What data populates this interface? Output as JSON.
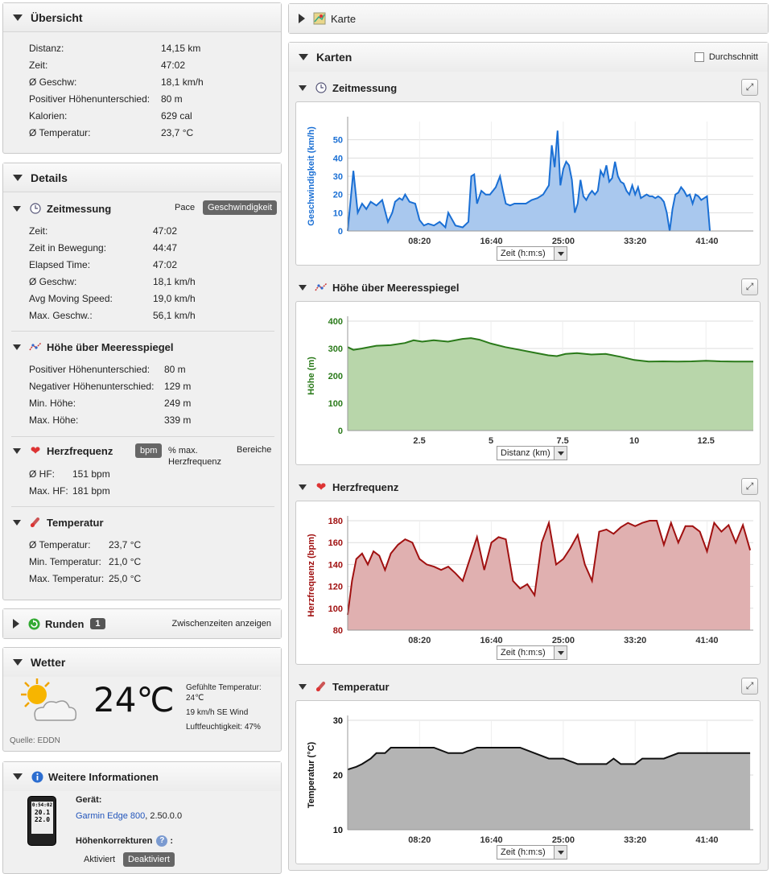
{
  "overview": {
    "title": "Übersicht",
    "rows": [
      {
        "label": "Distanz:",
        "value": "14,15 km"
      },
      {
        "label": "Zeit:",
        "value": "47:02"
      },
      {
        "label": "Ø Geschw:",
        "value": "18,1 km/h"
      },
      {
        "label": "Positiver Höhenunterschied:",
        "value": "80 m"
      },
      {
        "label": "Kalorien:",
        "value": "629 cal"
      },
      {
        "label": "Ø Temperatur:",
        "value": "23,7 °C"
      }
    ]
  },
  "details": {
    "title": "Details",
    "timing": {
      "title": "Zeitmessung",
      "pace_label": "Pace",
      "speed_label": "Geschwindigkeit",
      "rows": [
        {
          "label": "Zeit:",
          "value": "47:02"
        },
        {
          "label": "Zeit in Bewegung:",
          "value": "44:47"
        },
        {
          "label": "Elapsed Time:",
          "value": "47:02"
        },
        {
          "label": "Ø Geschw:",
          "value": "18,1 km/h"
        },
        {
          "label": "Avg Moving Speed:",
          "value": "19,0 km/h"
        },
        {
          "label": "Max. Geschw.:",
          "value": "56,1 km/h"
        }
      ]
    },
    "elevation": {
      "title": "Höhe über Meeresspiegel",
      "rows": [
        {
          "label": "Positiver Höhenunterschied:",
          "value": "80 m"
        },
        {
          "label": "Negativer Höhenunterschied:",
          "value": "129 m"
        },
        {
          "label": "Min. Höhe:",
          "value": "249 m"
        },
        {
          "label": "Max. Höhe:",
          "value": "339 m"
        }
      ]
    },
    "heartrate": {
      "title": "Herzfrequenz",
      "bpm_label": "bpm",
      "pct_label": "% max. Herzfrequenz",
      "zones_label": "Bereiche",
      "rows": [
        {
          "label": "Ø HF:",
          "value": "151 bpm"
        },
        {
          "label": "Max. HF:",
          "value": "181 bpm"
        }
      ]
    },
    "temperature": {
      "title": "Temperatur",
      "rows": [
        {
          "label": "Ø Temperatur:",
          "value": "23,7 °C"
        },
        {
          "label": "Min. Temperatur:",
          "value": "21,0 °C"
        },
        {
          "label": "Max. Temperatur:",
          "value": "25,0 °C"
        }
      ]
    }
  },
  "laps": {
    "title": "Runden",
    "count": "1",
    "link": "Zwischenzeiten anzeigen"
  },
  "weather": {
    "title": "Wetter",
    "temp": "24℃",
    "feels": "Gefühlte Temperatur: 24℃",
    "wind": "19 km/h SE Wind",
    "humidity": "Luftfeuchtigkeit: 47%",
    "source": "Quelle: EDDN"
  },
  "info": {
    "title": "Weitere Informationen",
    "device_label": "Gerät:",
    "device_name": "Garmin Edge 800",
    "device_version": ", 2.50.0.0",
    "elev_corr_label": "Höhenkorrekturen",
    "enabled": "Aktiviert",
    "disabled": "Deaktiviert",
    "screen_line1": "0:54:02",
    "screen_line2": "20.1",
    "screen_line3": "22.0"
  },
  "map": {
    "title": "Karte"
  },
  "charts_panel": {
    "title": "Karten",
    "average_label": "Durchschnitt"
  },
  "charts": [
    {
      "key": "speed",
      "title": "Zeitmessung",
      "ylabel": "Geschwindigkeit (km/h)",
      "selector": "Zeit (h:m:s)",
      "color": "#1a6fd4",
      "fill": "#a9c8ee",
      "chart_data": {
        "type": "area",
        "xlim": [
          0,
          2822
        ],
        "ylim": [
          0,
          60
        ],
        "yticks": [
          0,
          10,
          20,
          30,
          40,
          50
        ],
        "xticks": [
          500,
          1000,
          1500,
          2000,
          2500
        ],
        "xtick_labels": [
          "08:20",
          "16:40",
          "25:00",
          "33:20",
          "41:40"
        ],
        "x": [
          0,
          40,
          70,
          100,
          130,
          160,
          200,
          240,
          280,
          310,
          330,
          360,
          380,
          400,
          430,
          470,
          500,
          530,
          560,
          600,
          640,
          680,
          700,
          750,
          800,
          840,
          860,
          880,
          900,
          930,
          960,
          990,
          1030,
          1060,
          1080,
          1100,
          1130,
          1160,
          1200,
          1240,
          1280,
          1320,
          1360,
          1400,
          1420,
          1440,
          1460,
          1480,
          1500,
          1520,
          1540,
          1560,
          1580,
          1600,
          1620,
          1640,
          1660,
          1680,
          1700,
          1720,
          1740,
          1760,
          1780,
          1800,
          1820,
          1840,
          1860,
          1880,
          1900,
          1920,
          1940,
          1960,
          1980,
          2000,
          2020,
          2040,
          2060,
          2080,
          2100,
          2120,
          2140,
          2160,
          2180,
          2200,
          2220,
          2240,
          2260,
          2280,
          2300,
          2320,
          2340,
          2360,
          2380,
          2400,
          2420,
          2440,
          2460,
          2480,
          2500,
          2520,
          2540,
          2560,
          2580,
          2600,
          2620,
          2640,
          2660,
          2680,
          2700,
          2720,
          2740,
          2760,
          2780,
          2800
        ],
        "y": [
          0,
          33,
          10,
          15,
          12,
          16,
          14,
          17,
          5,
          10,
          16,
          18,
          17,
          20,
          16,
          15,
          6,
          3,
          4,
          3,
          5,
          2,
          10,
          3,
          2,
          5,
          30,
          31,
          15,
          22,
          20,
          20,
          24,
          30,
          22,
          15,
          14,
          15,
          15,
          15,
          17,
          18,
          20,
          25,
          47,
          35,
          55,
          25,
          34,
          38,
          36,
          28,
          10,
          15,
          28,
          19,
          17,
          20,
          22,
          20,
          22,
          33,
          30,
          36,
          27,
          29,
          38,
          30,
          27,
          26,
          22,
          20,
          25,
          20,
          24,
          18,
          19,
          20,
          19,
          19,
          18,
          19,
          18,
          16,
          10,
          0,
          12,
          20,
          21,
          24,
          22,
          19,
          20,
          15,
          20,
          19,
          17,
          18,
          19,
          0
        ],
        "series": [
          {
            "name": "",
            "values": []
          }
        ]
      }
    },
    {
      "key": "elevation",
      "title": "Höhe über Meeresspiegel",
      "ylabel": "Höhe (m)",
      "selector": "Distanz (km)",
      "color": "#2a7a1a",
      "fill": "#b8d6aa",
      "chart_data": {
        "type": "area",
        "xlim": [
          0,
          14.15
        ],
        "ylim": [
          0,
          400
        ],
        "yticks": [
          0,
          100,
          200,
          300,
          400
        ],
        "xticks": [
          2.5,
          5,
          7.5,
          10,
          12.5
        ],
        "xtick_labels": [
          "2.5",
          "5",
          "7.5",
          "10",
          "12.5"
        ],
        "x": [
          0,
          0.2,
          0.5,
          1,
          1.5,
          2,
          2.3,
          2.6,
          3,
          3.5,
          4,
          4.3,
          4.6,
          5,
          5.5,
          6,
          6.5,
          7,
          7.3,
          7.6,
          8,
          8.5,
          9,
          9.5,
          10,
          10.5,
          11,
          11.5,
          12,
          12.5,
          13,
          13.5,
          14.15
        ],
        "y": [
          305,
          295,
          300,
          310,
          312,
          320,
          330,
          325,
          330,
          325,
          335,
          338,
          332,
          318,
          305,
          295,
          285,
          275,
          272,
          280,
          283,
          278,
          280,
          270,
          258,
          252,
          253,
          252,
          253,
          255,
          253,
          252,
          252
        ]
      }
    },
    {
      "key": "heartrate",
      "title": "Herzfrequenz",
      "ylabel": "Herzfrequenz (bpm)",
      "selector": "Zeit (h:m:s)",
      "color": "#a01010",
      "fill": "#e0b0b0",
      "chart_data": {
        "type": "area",
        "xlim": [
          0,
          2822
        ],
        "ylim": [
          80,
          180
        ],
        "yticks": [
          80,
          100,
          120,
          140,
          160,
          180
        ],
        "xticks": [
          500,
          1000,
          1500,
          2000,
          2500
        ],
        "xtick_labels": [
          "08:20",
          "16:40",
          "25:00",
          "33:20",
          "41:40"
        ],
        "x": [
          0,
          30,
          60,
          100,
          140,
          180,
          220,
          260,
          300,
          350,
          400,
          450,
          500,
          550,
          600,
          650,
          700,
          750,
          800,
          850,
          900,
          950,
          1000,
          1050,
          1100,
          1150,
          1200,
          1250,
          1300,
          1350,
          1400,
          1450,
          1500,
          1550,
          1600,
          1650,
          1700,
          1750,
          1800,
          1850,
          1900,
          1950,
          2000,
          2050,
          2100,
          2150,
          2200,
          2250,
          2300,
          2350,
          2400,
          2450,
          2500,
          2550,
          2600,
          2650,
          2700,
          2750,
          2800
        ],
        "y": [
          94,
          125,
          145,
          150,
          140,
          152,
          148,
          135,
          150,
          158,
          163,
          160,
          145,
          140,
          138,
          135,
          138,
          132,
          125,
          145,
          165,
          135,
          160,
          165,
          163,
          125,
          118,
          122,
          112,
          160,
          178,
          140,
          145,
          155,
          167,
          140,
          125,
          170,
          172,
          168,
          174,
          178,
          175,
          178,
          180,
          180,
          158,
          178,
          160,
          175,
          175,
          170,
          152,
          178,
          170,
          176,
          160,
          176,
          153
        ]
      }
    },
    {
      "key": "temperature",
      "title": "Temperatur",
      "ylabel": "Temperatur (°C)",
      "selector": "Zeit (h:m:s)",
      "color": "#111111",
      "fill": "#b4b4b4",
      "chart_data": {
        "type": "area",
        "xlim": [
          0,
          2822
        ],
        "ylim": [
          10,
          30
        ],
        "yticks": [
          10,
          20,
          30
        ],
        "xticks": [
          500,
          1000,
          1500,
          2000,
          2500
        ],
        "xtick_labels": [
          "08:20",
          "16:40",
          "25:00",
          "33:20",
          "41:40"
        ],
        "x": [
          0,
          60,
          100,
          160,
          200,
          260,
          300,
          400,
          500,
          600,
          700,
          800,
          900,
          1000,
          1100,
          1200,
          1300,
          1400,
          1450,
          1500,
          1600,
          1700,
          1800,
          1850,
          1900,
          1950,
          2000,
          2050,
          2100,
          2200,
          2300,
          2400,
          2500,
          2600,
          2700,
          2800
        ],
        "y": [
          21,
          21.5,
          22,
          23,
          24,
          24,
          25,
          25,
          25,
          25,
          24,
          24,
          25,
          25,
          25,
          25,
          24,
          23,
          23,
          23,
          22,
          22,
          22,
          23,
          22,
          22,
          22,
          23,
          23,
          23,
          24,
          24,
          24,
          24,
          24,
          24
        ]
      }
    }
  ]
}
